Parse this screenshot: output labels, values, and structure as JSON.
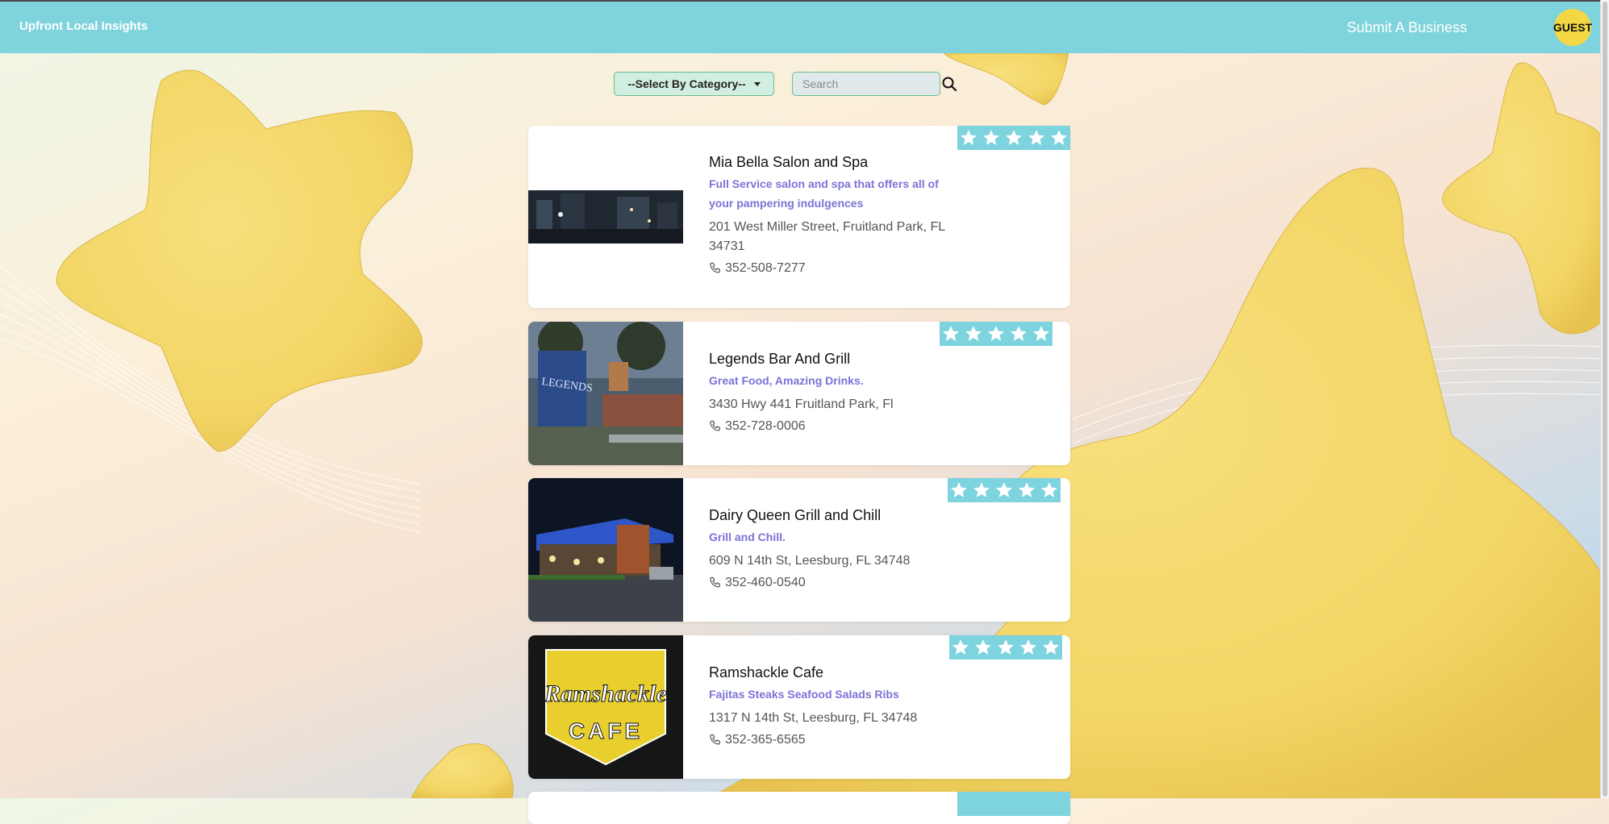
{
  "header": {
    "brand": "Upfront Local Insights",
    "submit_label": "Submit A Business",
    "user_label": "GUEST"
  },
  "filters": {
    "category_label": "--Select By Category--",
    "search_placeholder": "Search"
  },
  "listings": [
    {
      "name": "Mia Bella Salon and Spa",
      "tagline": "Full Service salon and spa that offers all of your pampering indulgences",
      "address": "201 West Miller Street, Fruitland Park, FL 34731",
      "phone": "352-508-7277",
      "rating": 5
    },
    {
      "name": "Legends Bar And Grill",
      "tagline": "Great Food, Amazing Drinks.",
      "address": "3430 Hwy 441 Fruitland Park, Fl",
      "phone": "352-728-0006",
      "rating": 5
    },
    {
      "name": "Dairy Queen Grill and Chill",
      "tagline": "Grill and Chill.",
      "address": "609 N 14th St, Leesburg, FL 34748",
      "phone": "352-460-0540",
      "rating": 5
    },
    {
      "name": "Ramshackle Cafe",
      "tagline": "Fajitas Steaks Seafood Salads Ribs",
      "address": "1317 N 14th St, Leesburg, FL 34748",
      "phone": "352-365-6565",
      "rating": 5,
      "logo_text_top": "Ramshackle",
      "logo_text_bottom": "CAFE"
    }
  ],
  "colors": {
    "header": "#7fd3dc",
    "tagline": "#7b73d6",
    "star_box": "#7dd3de",
    "guest_badge": "#f4d745"
  }
}
